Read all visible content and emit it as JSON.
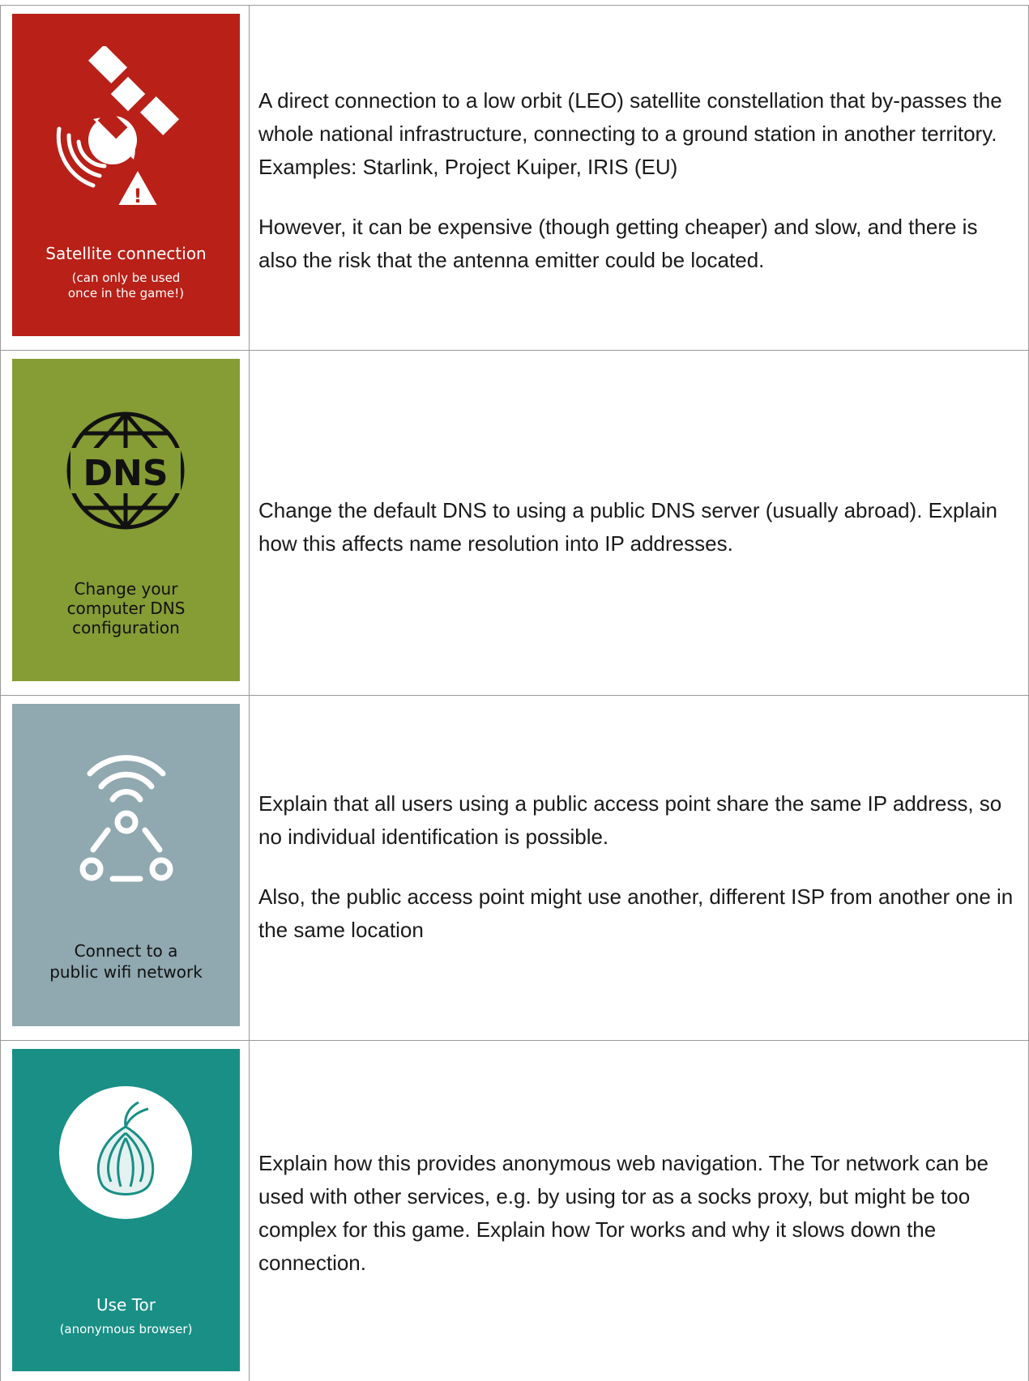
{
  "colors": {
    "satellite_card": "#b82018",
    "dns_card": "#869c35",
    "wifi_card": "#90a8b0",
    "tor_card": "#198f85",
    "border": "#9a9a9a",
    "text": "#1a1a1a"
  },
  "rows": [
    {
      "card": {
        "icon": "satellite-warning-icon",
        "title": "Satellite connection",
        "subtitle_line1": "(can only be used",
        "subtitle_line2": "once in the game!)"
      },
      "paragraphs": [
        "A direct connection to a low orbit (LEO) satellite constellation that by-passes the whole national infrastructure, connecting to a ground station in another territory. Examples: Starlink, Project Kuiper, IRIS (EU)",
        "However, it can be expensive (though getting cheaper) and slow, and there is also the risk that the antenna emitter  could be located."
      ]
    },
    {
      "card": {
        "icon": "dns-globe-icon",
        "icon_text": "DNS",
        "title_line1": "Change your",
        "title_line2": "computer DNS",
        "title_line3": "configuration"
      },
      "paragraphs": [
        "Change the default DNS to using a public DNS server (usually abroad). Explain how this affects name resolution into IP addresses."
      ]
    },
    {
      "card": {
        "icon": "public-wifi-icon",
        "title_line1": "Connect to a",
        "title_line2": "public wifi network"
      },
      "paragraphs": [
        "Explain that all users using a public access point share the same IP address, so no individual identification is possible.",
        "Also, the public access point might use another, different ISP from another one in the same location"
      ]
    },
    {
      "card": {
        "icon": "tor-onion-icon",
        "title": "Use Tor",
        "subtitle": "(anonymous browser)"
      },
      "paragraphs": [
        "Explain how this provides anonymous web navigation. The Tor network can be used with other services, e.g. by using tor as a socks proxy, but might be too complex for this game. Explain how Tor works and why it slows down the connection."
      ]
    }
  ]
}
